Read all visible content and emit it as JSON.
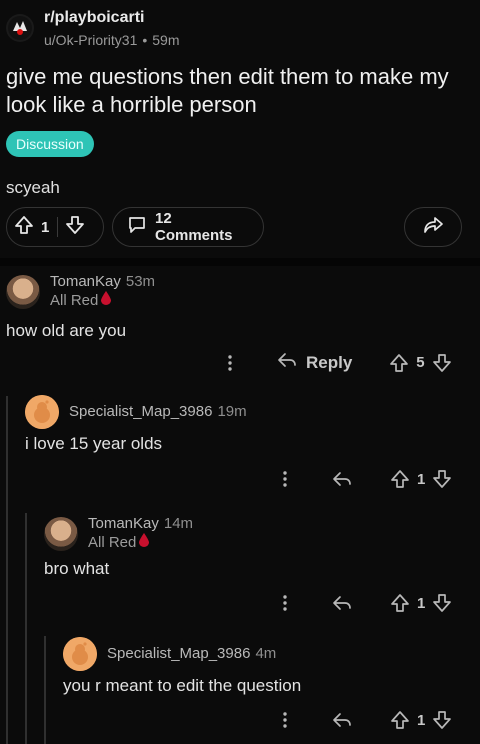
{
  "post": {
    "subreddit": "r/playboicarti",
    "author": "u/Ok-Priority31",
    "time": "59m",
    "title": "give me questions then edit them to make my look like a horrible person",
    "flair": "Discussion",
    "body": "scyeah",
    "score": "1",
    "comments_label": "12 Comments"
  },
  "comments": [
    {
      "author": "TomanKay",
      "time": "53m",
      "flair": "All Red",
      "text": "how old are you",
      "reply_label": "Reply",
      "score": "5"
    },
    {
      "author": "Specialist_Map_3986",
      "time": "19m",
      "text": "i love 15 year olds",
      "score": "1"
    },
    {
      "author": "TomanKay",
      "time": "14m",
      "flair": "All Red",
      "text": "bro what",
      "score": "1"
    },
    {
      "author": "Specialist_Map_3986",
      "time": "4m",
      "text": "you r meant to edit the question",
      "score": "1"
    }
  ],
  "colors": {
    "flair": "#2ec4b6",
    "background": "#0b0b0b",
    "blood_drop": "#c8102e"
  },
  "icons": [
    "subreddit-avatar-icon",
    "upvote-icon",
    "downvote-icon",
    "comment-icon",
    "share-icon",
    "more-icon",
    "reply-icon",
    "blood-drop-icon"
  ]
}
